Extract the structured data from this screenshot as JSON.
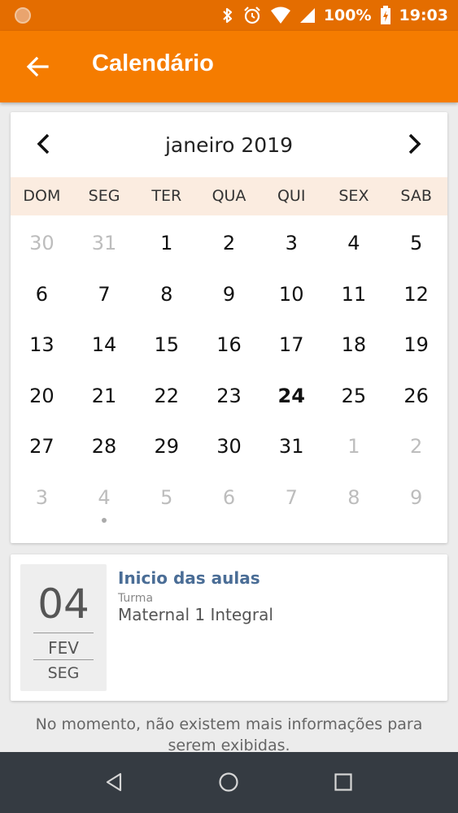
{
  "status_bar": {
    "battery": "100%",
    "time": "19:03"
  },
  "app_bar": {
    "title": "Calendário"
  },
  "calendar": {
    "month_label": "janeiro 2019",
    "weekdays": [
      "DOM",
      "SEG",
      "TER",
      "QUA",
      "QUI",
      "SEX",
      "SAB"
    ],
    "days": [
      {
        "n": "30",
        "muted": true
      },
      {
        "n": "31",
        "muted": true
      },
      {
        "n": "1"
      },
      {
        "n": "2"
      },
      {
        "n": "3"
      },
      {
        "n": "4"
      },
      {
        "n": "5"
      },
      {
        "n": "6"
      },
      {
        "n": "7"
      },
      {
        "n": "8"
      },
      {
        "n": "9"
      },
      {
        "n": "10"
      },
      {
        "n": "11"
      },
      {
        "n": "12"
      },
      {
        "n": "13"
      },
      {
        "n": "14"
      },
      {
        "n": "15"
      },
      {
        "n": "16"
      },
      {
        "n": "17"
      },
      {
        "n": "18"
      },
      {
        "n": "19"
      },
      {
        "n": "20"
      },
      {
        "n": "21"
      },
      {
        "n": "22"
      },
      {
        "n": "23"
      },
      {
        "n": "24",
        "today": true
      },
      {
        "n": "25"
      },
      {
        "n": "26"
      },
      {
        "n": "27"
      },
      {
        "n": "28"
      },
      {
        "n": "29"
      },
      {
        "n": "30"
      },
      {
        "n": "31"
      },
      {
        "n": "1",
        "muted": true
      },
      {
        "n": "2",
        "muted": true
      },
      {
        "n": "3",
        "muted": true
      },
      {
        "n": "4",
        "muted": true,
        "event": true
      },
      {
        "n": "5",
        "muted": true
      },
      {
        "n": "6",
        "muted": true
      },
      {
        "n": "7",
        "muted": true
      },
      {
        "n": "8",
        "muted": true
      },
      {
        "n": "9",
        "muted": true
      }
    ]
  },
  "event": {
    "day": "04",
    "month": "FEV",
    "weekday": "SEG",
    "title": "Inicio das aulas",
    "class_label": "Turma",
    "class_value": "Maternal 1 Integral"
  },
  "empty_message": "No momento, não existem mais informações para serem exibidas.",
  "colors": {
    "status_bar": "#e46d00",
    "app_bar": "#f57c00",
    "weekday_bg": "#fbece0",
    "event_title": "#4a6d96",
    "nav_bar": "#353b42"
  }
}
